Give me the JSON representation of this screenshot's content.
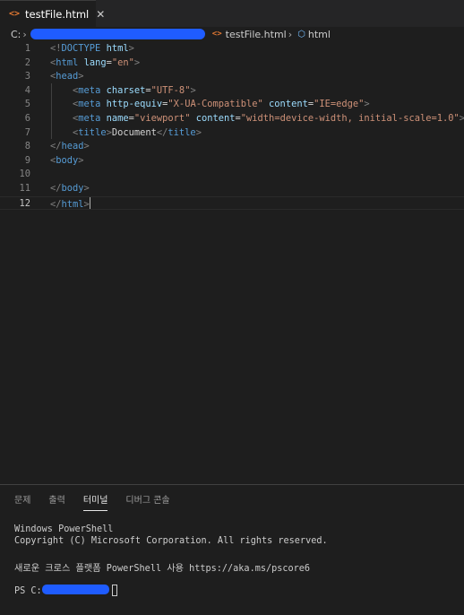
{
  "tab": {
    "icon": "html-file-icon",
    "icon_glyph": "<>",
    "label": "testFile.html",
    "close": "✕"
  },
  "breadcrumb": {
    "drive": "C:",
    "file_icon_glyph": "<>",
    "file": "testFile.html",
    "symbol_icon": "cube-icon",
    "symbol": "html"
  },
  "editor": {
    "active_line": 12,
    "line_numbers": [
      "1",
      "2",
      "3",
      "4",
      "5",
      "6",
      "7",
      "8",
      "9",
      "10",
      "11",
      "12"
    ],
    "lines": [
      "<!DOCTYPE html>",
      "<html lang=\"en\">",
      "<head>",
      "    <meta charset=\"UTF-8\">",
      "    <meta http-equiv=\"X-UA-Compatible\" content=\"IE=edge\">",
      "    <meta name=\"viewport\" content=\"width=device-width, initial-scale=1.0\">",
      "    <title>Document</title>",
      "</head>",
      "<body>",
      "",
      "</body>",
      "</html>"
    ]
  },
  "panel": {
    "tabs": [
      "문제",
      "출력",
      "터미널",
      "디버그 콘솔"
    ],
    "active_tab": "터미널"
  },
  "terminal": {
    "lines": [
      "Windows PowerShell",
      "Copyright (C) Microsoft Corporation. All rights reserved.",
      "새로운 크로스 플랫폼 PowerShell 사용 https://aka.ms/pscore6"
    ],
    "prompt": "PS C:"
  },
  "colors": {
    "background": "#1e1e1e",
    "tag": "#569cd6",
    "attribute": "#9cdcfe",
    "string": "#ce9178",
    "bracket": "#808080",
    "redaction": "#1f5cff"
  }
}
